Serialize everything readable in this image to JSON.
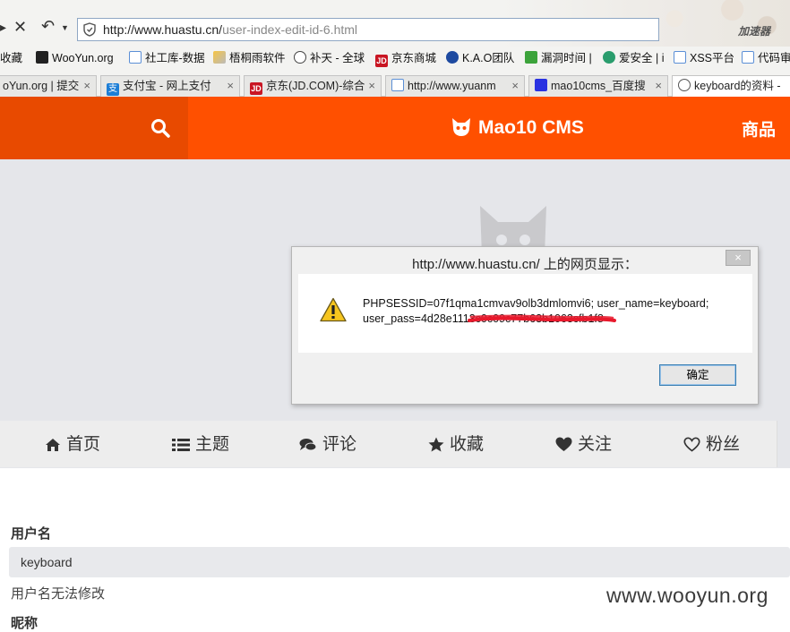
{
  "browser": {
    "url_host": "http://www.huastu.cn/",
    "url_path": "user-index-edit-id-6.html",
    "accelerator_label": "加速器",
    "bookmarks": [
      "收藏",
      "WooYun.org",
      "社工库-数据",
      "梧桐雨软件",
      "补天 - 全球",
      "京东商城",
      "K.A.O团队",
      "漏洞时间 |",
      "爱安全 | i",
      "XSS平台",
      "代码审"
    ],
    "tabs": [
      "oYun.org | 提交",
      "支付宝 - 网上支付",
      "京东(JD.COM)-综合",
      "http://www.yuanm",
      "mao10cms_百度搜",
      "keyboard的资料 -"
    ]
  },
  "header": {
    "logo_text": "Mao10 CMS",
    "goods_label": "商品"
  },
  "nav_tabs": [
    {
      "label": "首页",
      "icon": "home-icon"
    },
    {
      "label": "主题",
      "icon": "list-icon"
    },
    {
      "label": "评论",
      "icon": "comments-icon"
    },
    {
      "label": "收藏",
      "icon": "star-icon"
    },
    {
      "label": "关注",
      "icon": "heart-icon"
    },
    {
      "label": "粉丝",
      "icon": "heart-outline-icon"
    }
  ],
  "form": {
    "username_label": "用户名",
    "username_value": "keyboard",
    "username_hint": "用户名无法修改",
    "nickname_label": "昵称"
  },
  "dialog": {
    "title": "http://www.huastu.cn/ 上的网页显示：",
    "close_label": "×",
    "message_line1": "PHPSESSID=07f1qma1cmvav9olb3dmlomvi6; user_name=keyboard;",
    "message_line2": "user_pass=4d28e1113c0c09c77b63b1063cfb1f8",
    "ok_label": "确定"
  },
  "watermark": "www.wooyun.org",
  "colors": {
    "header_orange": "#ff5000",
    "search_block": "#e84a00",
    "banner_gray": "#e5e6ea",
    "redaction_red": "#e8192c"
  }
}
